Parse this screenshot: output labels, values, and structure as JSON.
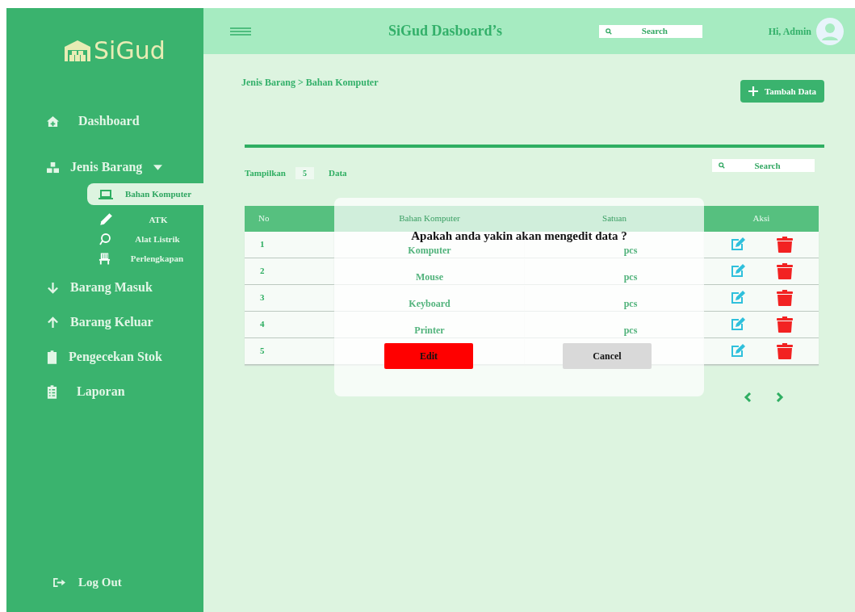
{
  "sidebar": {
    "logo": "SiGud",
    "items": [
      {
        "label": "Dashboard"
      },
      {
        "label": "Jenis Barang",
        "expanded": true,
        "children": [
          {
            "label": "Bahan Komputer",
            "selected": true
          },
          {
            "label": "ATK",
            "selected": false
          },
          {
            "label": "Alat Listrik",
            "selected": false
          },
          {
            "label": "Perlengkapan",
            "selected": false
          }
        ]
      },
      {
        "label": "Barang Masuk"
      },
      {
        "label": "Barang Keluar"
      },
      {
        "label": "Pengecekan Stok"
      },
      {
        "label": "Laporan"
      }
    ],
    "logout": "Log Out"
  },
  "header": {
    "title": "SiGud Dasboard’s",
    "search": {
      "placeholder": "Search"
    },
    "greeting": "Hi, Admin"
  },
  "breadcrumb": "Jenis Barang > Bahan Komputer",
  "add_button": "Tambah Data",
  "page_size": {
    "label": "Tampilkan",
    "value": "5",
    "suffix": "Data"
  },
  "table_search": {
    "placeholder": "Search"
  },
  "table": {
    "columns": [
      "No",
      "Bahan Komputer",
      "Satuan",
      "Aksi"
    ],
    "rows": [
      {
        "no": "1",
        "name": "Komputer",
        "unit": "pcs"
      },
      {
        "no": "2",
        "name": "Mouse",
        "unit": "pcs"
      },
      {
        "no": "3",
        "name": "Keyboard",
        "unit": "pcs"
      },
      {
        "no": "4",
        "name": "Printer",
        "unit": "pcs"
      },
      {
        "no": "5"
      }
    ]
  },
  "dialog": {
    "message": "Apakah anda yakin akan mengedit data ?",
    "buttons": [
      {
        "label": "Edit",
        "kind": "confirm"
      },
      {
        "label": "Cancel",
        "kind": "cancel"
      }
    ]
  }
}
